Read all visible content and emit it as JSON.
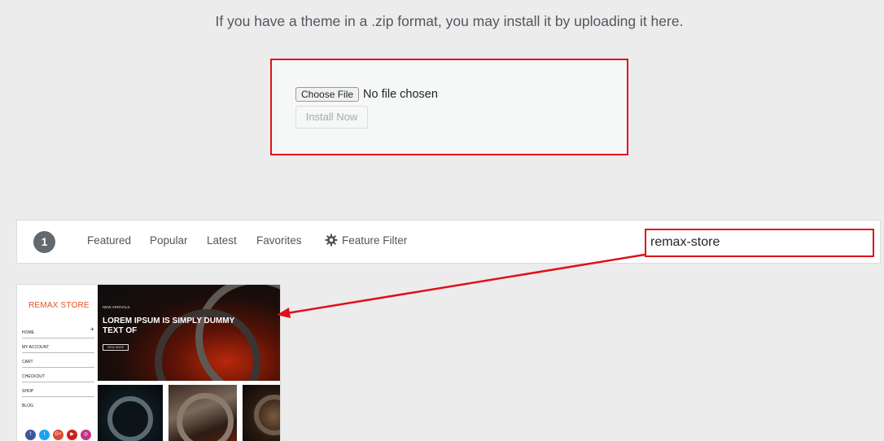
{
  "upload": {
    "description": "If you have a theme in a .zip format, you may install it by uploading it here.",
    "choose_file_label": "Choose File",
    "no_file_text": "No file chosen",
    "install_label": "Install Now"
  },
  "filter_bar": {
    "count": "1",
    "tabs": [
      {
        "label": "Featured"
      },
      {
        "label": "Popular"
      },
      {
        "label": "Latest"
      },
      {
        "label": "Favorites"
      }
    ],
    "feature_filter_label": "Feature Filter",
    "feature_filter_icon": "gear-icon",
    "search_value": "remax-store"
  },
  "theme_card": {
    "store_name": "REMAX STORE",
    "nav_items": [
      "HOME",
      "MY ACCOUNT",
      "CART",
      "CHECKOUT",
      "SHOP",
      "BLOG"
    ],
    "hero_small": "NEW ARRIVALS",
    "hero_title": "LOREM IPSUM IS SIMPLY DUMMY TEXT OF",
    "hero_button": "VIEW MORE",
    "social_icons": [
      {
        "name": "facebook-icon",
        "glyph": "f",
        "color": "#3b5998"
      },
      {
        "name": "twitter-icon",
        "glyph": "t",
        "color": "#1da1f2"
      },
      {
        "name": "google-plus-icon",
        "glyph": "G+",
        "color": "#dd4b39"
      },
      {
        "name": "youtube-icon",
        "glyph": "▶",
        "color": "#cd201f"
      },
      {
        "name": "instagram-icon",
        "glyph": "◎",
        "color": "#c13584"
      }
    ]
  },
  "colors": {
    "highlight": "#e0101a",
    "brand_orange": "#e0541f"
  }
}
